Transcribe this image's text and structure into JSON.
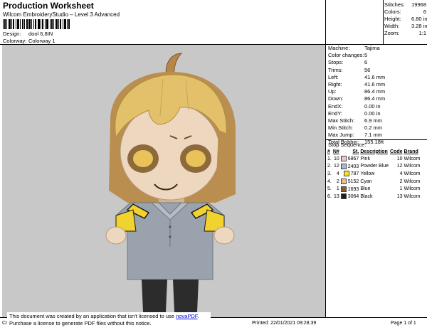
{
  "header": {
    "title": "Production Worksheet",
    "subtitle": "Wilcom EmbroideryStudio – Level 3 Advanced",
    "design_label": "Design:",
    "design_value": "dool 6,8IN",
    "colorway_label": "Colorway:",
    "colorway_value": "Colorway 1"
  },
  "stats": [
    {
      "label": "Stitches:",
      "value": "19968"
    },
    {
      "label": "Colors:",
      "value": "6"
    },
    {
      "label": "Height:",
      "value": "6.80 in"
    },
    {
      "label": "Width:",
      "value": "3.28 in"
    },
    {
      "label": "Zoom:",
      "value": "1:1"
    }
  ],
  "specs": [
    {
      "label": "Machine:",
      "value": "Tajima"
    },
    {
      "label": "Color changes:",
      "value": "5"
    },
    {
      "label": "Stops:",
      "value": "6"
    },
    {
      "label": "Trims:",
      "value": "56"
    },
    {
      "label": "Left:",
      "value": "41.6 mm"
    },
    {
      "label": "Right:",
      "value": "41.6 mm"
    },
    {
      "label": "Up:",
      "value": "86.4 mm"
    },
    {
      "label": "Down:",
      "value": "86.4 mm"
    },
    {
      "label": "EndX:",
      "value": "0.00 in"
    },
    {
      "label": "EndY:",
      "value": "0.00 in"
    },
    {
      "label": "Max Stitch:",
      "value": "6.9 mm"
    },
    {
      "label": "Min Stitch:",
      "value": "0.2 mm"
    },
    {
      "label": "Max Jump:",
      "value": "7.1 mm"
    },
    {
      "label": "Total Bobbin:",
      "value": "155.18ft"
    }
  ],
  "stop_sequence": {
    "title": "Stop Sequence:",
    "headers": [
      "#",
      "N#",
      "St.",
      "Description",
      "Code",
      "Brand"
    ],
    "rows": [
      {
        "num": "1.",
        "n": "10",
        "color": "#f2c3c6",
        "st": "6867",
        "desc": "Pink",
        "code": "10",
        "brand": "Wilcom"
      },
      {
        "num": "2.",
        "n": "12",
        "color": "#a9b6d6",
        "st": "2403",
        "desc": "Powder Blue",
        "code": "12",
        "brand": "Wilcom"
      },
      {
        "num": "3.",
        "n": "4",
        "color": "#f5e31c",
        "st": "787",
        "desc": "Yellow",
        "code": "4",
        "brand": "Wilcom"
      },
      {
        "num": "4.",
        "n": "2",
        "color": "#e8c27a",
        "st": "5152",
        "desc": "Cyan",
        "code": "2",
        "brand": "Wilcom"
      },
      {
        "num": "5.",
        "n": "1",
        "color": "#8c5a2b",
        "st": "1693",
        "desc": "Blue",
        "code": "1",
        "brand": "Wilcom"
      },
      {
        "num": "6.",
        "n": "13",
        "color": "#1e1e1e",
        "st": "3064",
        "desc": "Black",
        "code": "13",
        "brand": "Wilcom"
      }
    ]
  },
  "notice": {
    "line1": "This document was created by an application that isn't licensed to use",
    "link": "novaPDF",
    "line2": "Purchase a license to generate PDF files without this notice."
  },
  "footer": {
    "left": "Cr",
    "printed": "Printed: 22/01/2021 09:28:39",
    "page": "Page 1 of 1"
  },
  "colors": {
    "canvas": "#c8c8c8",
    "hair": "#e8c46a",
    "skin": "#f1d6bc",
    "shirt": "#9aa3ad",
    "pants": "#2c2c2c",
    "accent_yellow": "#f2d22e"
  }
}
